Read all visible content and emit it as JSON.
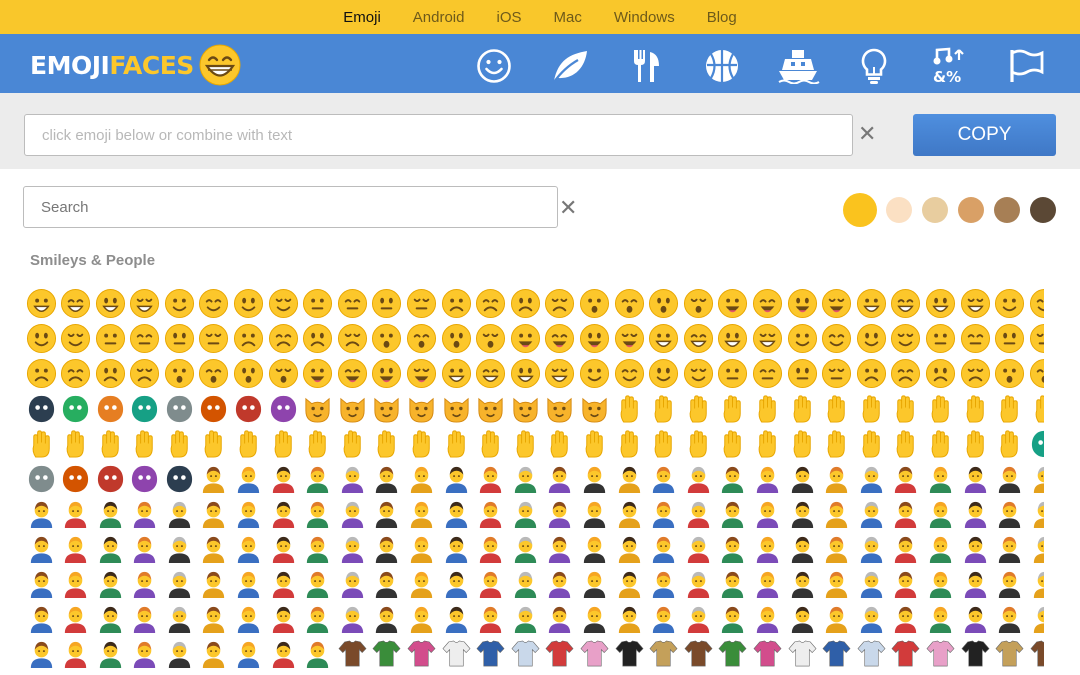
{
  "top_nav": {
    "items": [
      "Emoji",
      "Android",
      "iOS",
      "Mac",
      "Windows",
      "Blog"
    ],
    "active": "Emoji"
  },
  "logo": {
    "part1": "EMOJI",
    "part2": "FACES"
  },
  "category_icons": [
    "smiley-icon",
    "leaf-icon",
    "fork-knife-icon",
    "basketball-icon",
    "ship-icon",
    "lightbulb-icon",
    "symbols-icon",
    "flag-icon"
  ],
  "composer": {
    "placeholder": "click emoji below or combine with text",
    "clear": "✕"
  },
  "copy_button": {
    "label": "COPY"
  },
  "search": {
    "placeholder": "Search",
    "clear": "✕"
  },
  "skin_tones": [
    "#fac31e",
    "#fbe0c3",
    "#e8cd9f",
    "#d9a066",
    "#a77f55",
    "#5b4835"
  ],
  "section": {
    "title": "Smileys & People"
  },
  "colors": {
    "accent_yellow": "#f9c72b",
    "header_blue": "#4a87d5",
    "button_blue": "#4580cf"
  }
}
